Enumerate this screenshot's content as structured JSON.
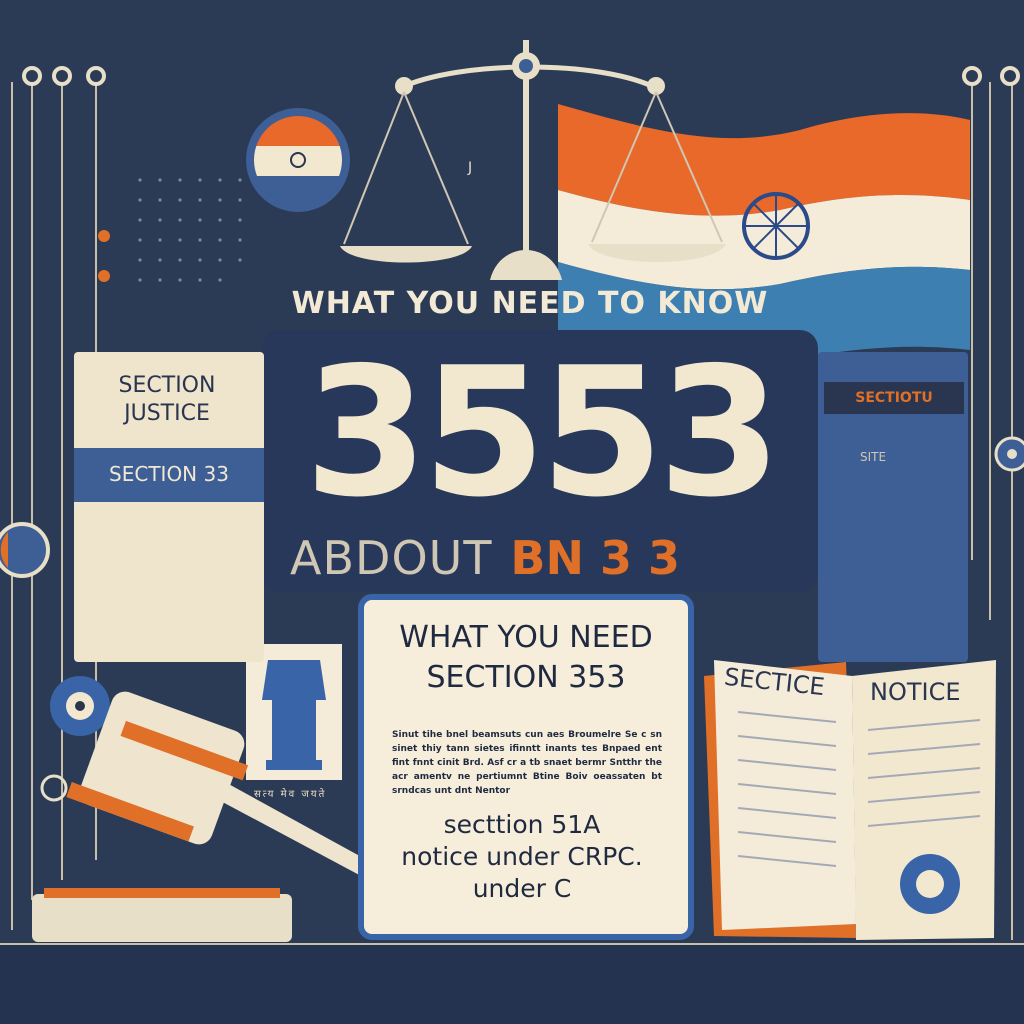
{
  "headline": "WHAT YOU NEED TO  KNOW",
  "big_number": "3553",
  "about_text": "ABDOUT",
  "about_suffix": "BN   3 3",
  "left_book": {
    "title": "SECTION JUSTICE",
    "band_label": "SECTION 33"
  },
  "right_book": {
    "label": "SECTIOTU",
    "sub": "SITE"
  },
  "notice_card": {
    "heading_line1": "WHAT YOU NEED",
    "heading_line2": "SECTION 353",
    "body_text": "Sinut tihe bnel beamsuts cun aes Broumelre Se c sn sinet thiy tann sietes ifinntt inants tes Bnpaed ent fint fnnt cinit Brd. Asf cr a tb snaet bermr Sntthr the acr amentv ne pertiumnt Btine Boiv oeassaten bt srndcas unt dnt Nentor",
    "line1": "secttion 51A",
    "line2": "notice under CRPC.",
    "line3": "under C"
  },
  "open_book": {
    "left_label": "SECTICE",
    "right_label": "NOTICE"
  },
  "emblem_caption": "सत्य मेव जयते",
  "j_mark": "J",
  "colors": {
    "background": "#2b3b55",
    "panel": "#27385a",
    "cream": "#f2e7cf",
    "saffron": "#e07028",
    "blue": "#3d5f95",
    "navy_text": "#1f2a40"
  }
}
